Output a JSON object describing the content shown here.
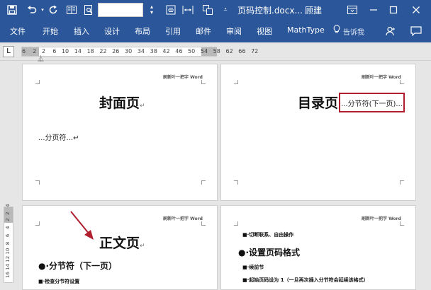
{
  "title_bar": {
    "font_size_value": "",
    "doc_title": "页码控制.docx...",
    "user_name": "顾建",
    "icons": [
      "save-icon",
      "undo-icon",
      "undo-dropdown-icon",
      "redo-icon",
      "columns-icon",
      "print-preview-icon",
      "font-size-spin-icon",
      "align-center-icon",
      "spacing-icon",
      "page-layout-icon",
      "customize-dropdown-icon",
      "ribbon-display-icon",
      "minimize-icon",
      "maximize-icon",
      "close-icon"
    ]
  },
  "ribbon": {
    "tabs": [
      "文件",
      "开始",
      "插入",
      "设计",
      "布局",
      "引用",
      "邮件",
      "审阅",
      "视图",
      "MathType"
    ],
    "tell_me": "告诉我",
    "icons": [
      "lightbulb-icon",
      "person-icon",
      "comment-icon"
    ]
  },
  "ruler": {
    "tab_selector": "L",
    "numbers": "6    2   2    6   10   14   18   22   26   30   34   38   42   46   50   54   58   62   66   72"
  },
  "vertical_ruler": {
    "numbers": "16 14 12 10  8   6   4   2  2   4"
  },
  "pages": {
    "header_text": "刷新叶一把字 Word",
    "cover": {
      "title": "封面页",
      "para_mark": "↵",
      "break_text": "...分页符...↵"
    },
    "toc": {
      "title": "目录页",
      "break_box": "...分节符(下一页)..."
    },
    "body": {
      "title": "正文页",
      "para_mark": "↵",
      "item1": "●·分节符（下一页）",
      "item2": "■·检查分节符设置"
    },
    "body2": {
      "item1": "■·切断联系、自由操作",
      "item2": "●·设置页码格式",
      "item3": "■·续前节",
      "item4": "■·起始页码设为 1（一旦再次插入分节符会延续该格式）"
    }
  },
  "colors": {
    "title_bar": "#2b579a",
    "ribbon": "#2b579a",
    "canvas": "#e6e6e6",
    "annotation": "#b01e2e"
  }
}
